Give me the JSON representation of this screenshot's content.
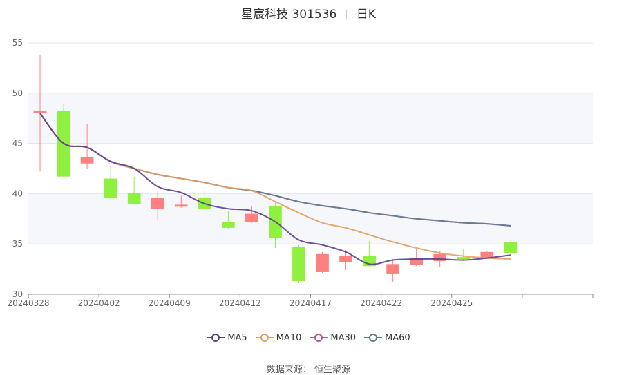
{
  "title": {
    "stock": "星宸科技 301536",
    "period": "日K"
  },
  "source_text": "数据来源： 恒生聚源",
  "colors": {
    "up": "#ff8080",
    "down": "#90f040",
    "ma5": "#5b3d8f",
    "ma10": "#e0a060",
    "ma30": "#c05090",
    "ma60": "#5a7f92"
  },
  "chart_data": {
    "type": "candlestick",
    "ylim": [
      30,
      55
    ],
    "y_ticks": [
      30,
      35,
      40,
      45,
      50,
      55
    ],
    "x_tick_labels": [
      "20240328",
      "20240402",
      "20240409",
      "20240412",
      "20240417",
      "20240422",
      "20240425"
    ],
    "x_tick_indices": [
      0,
      3,
      6,
      9,
      12,
      15,
      18
    ],
    "total_slots": 24,
    "candles": [
      {
        "o": 48.0,
        "c": 48.2,
        "h": 53.8,
        "l": 42.2
      },
      {
        "o": 48.2,
        "c": 41.7,
        "h": 48.9,
        "l": 41.6
      },
      {
        "o": 43.0,
        "c": 43.6,
        "h": 46.9,
        "l": 42.5
      },
      {
        "o": 41.5,
        "c": 39.6,
        "h": 42.8,
        "l": 39.3
      },
      {
        "o": 40.1,
        "c": 39.0,
        "h": 41.7,
        "l": 38.9
      },
      {
        "o": 38.5,
        "c": 39.6,
        "h": 40.2,
        "l": 37.4
      },
      {
        "o": 38.7,
        "c": 38.9,
        "h": 39.8,
        "l": 38.6
      },
      {
        "o": 39.6,
        "c": 38.5,
        "h": 40.4,
        "l": 38.4
      },
      {
        "o": 37.2,
        "c": 36.6,
        "h": 38.3,
        "l": 36.5
      },
      {
        "o": 37.2,
        "c": 38.0,
        "h": 38.8,
        "l": 37.1
      },
      {
        "o": 38.8,
        "c": 35.6,
        "h": 39.1,
        "l": 34.6
      },
      {
        "o": 34.7,
        "c": 31.3,
        "h": 34.9,
        "l": 31.1
      },
      {
        "o": 32.2,
        "c": 34.0,
        "h": 34.2,
        "l": 32.1
      },
      {
        "o": 33.2,
        "c": 33.8,
        "h": 34.4,
        "l": 32.4
      },
      {
        "o": 33.8,
        "c": 32.8,
        "h": 35.3,
        "l": 32.7
      },
      {
        "o": 32.0,
        "c": 33.0,
        "h": 33.5,
        "l": 31.2
      },
      {
        "o": 32.9,
        "c": 33.6,
        "h": 34.5,
        "l": 32.8
      },
      {
        "o": 33.3,
        "c": 34.0,
        "h": 34.3,
        "l": 32.7
      },
      {
        "o": 33.7,
        "c": 33.5,
        "h": 34.5,
        "l": 33.3
      },
      {
        "o": 33.6,
        "c": 34.2,
        "h": 34.3,
        "l": 33.5
      },
      {
        "o": 35.2,
        "c": 34.1,
        "h": 35.3,
        "l": 34.0
      }
    ],
    "series": [
      {
        "name": "MA5",
        "key": "ma5",
        "values": [
          48.0,
          45.0,
          44.6,
          43.2,
          42.5,
          40.7,
          40.1,
          39.0,
          38.5,
          38.3,
          37.2,
          35.4,
          34.9,
          34.2,
          33.0,
          33.4,
          33.5,
          33.5,
          33.4,
          33.6,
          33.9
        ]
      },
      {
        "name": "MA10",
        "key": "ma10",
        "values": [
          48.0,
          45.0,
          44.6,
          43.2,
          42.5,
          41.9,
          41.5,
          41.1,
          40.6,
          40.3,
          39.2,
          38.1,
          37.1,
          36.6,
          35.9,
          35.2,
          34.6,
          34.1,
          33.8,
          33.6,
          33.5
        ]
      },
      {
        "name": "MA30",
        "key": "ma30",
        "values": [
          48.0,
          45.0,
          44.6,
          43.2,
          42.5,
          41.9,
          41.5,
          41.1,
          40.6,
          40.3,
          39.8,
          39.2,
          38.8,
          38.5,
          38.1,
          37.8,
          37.5,
          37.3,
          37.1,
          37.0,
          36.8
        ]
      },
      {
        "name": "MA60",
        "key": "ma60",
        "values": [
          48.0,
          45.0,
          44.6,
          43.2,
          42.5,
          41.9,
          41.5,
          41.1,
          40.6,
          40.3,
          39.8,
          39.2,
          38.8,
          38.5,
          38.1,
          37.8,
          37.5,
          37.3,
          37.1,
          37.0,
          36.8
        ]
      }
    ]
  }
}
